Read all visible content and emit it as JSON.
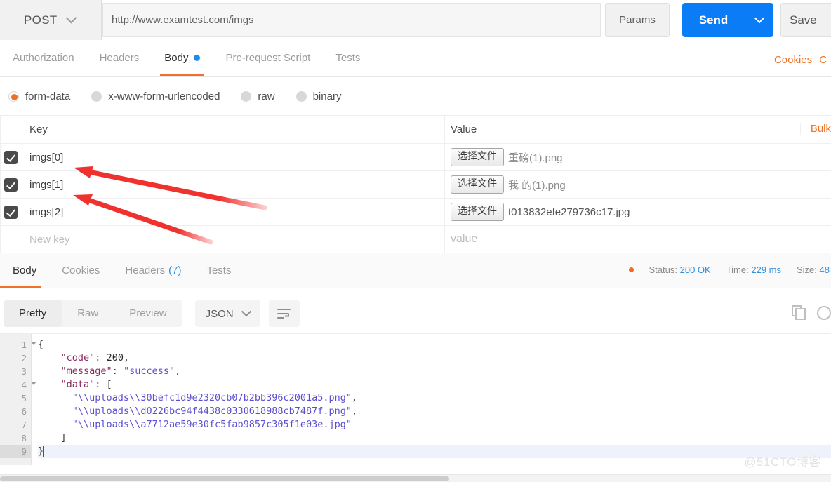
{
  "request": {
    "method": "POST",
    "url": "http://www.examtest.com/imgs",
    "params_label": "Params",
    "send_label": "Send",
    "save_label": "Save",
    "tabs": [
      {
        "label": "Authorization",
        "active": false,
        "dot": false
      },
      {
        "label": "Headers",
        "active": false,
        "dot": false
      },
      {
        "label": "Body",
        "active": true,
        "dot": true
      },
      {
        "label": "Pre-request Script",
        "active": false,
        "dot": false
      },
      {
        "label": "Tests",
        "active": false,
        "dot": false
      }
    ],
    "cookies_link": "Cookies",
    "cookies_link_cut": "C",
    "body_types": [
      {
        "label": "form-data",
        "selected": true
      },
      {
        "label": "x-www-form-urlencoded",
        "selected": false
      },
      {
        "label": "raw",
        "selected": false
      },
      {
        "label": "binary",
        "selected": false
      }
    ],
    "table": {
      "col_key": "Key",
      "col_value": "Value",
      "bulk_label": "Bulk",
      "file_btn_label": "选择文件",
      "new_key_placeholder": "New key",
      "new_value_placeholder": "value",
      "rows": [
        {
          "checked": true,
          "key": "imgs[0]",
          "file": "重磅(1).png",
          "grey": true
        },
        {
          "checked": true,
          "key": "imgs[1]",
          "file": "我 的(1).png",
          "grey": true
        },
        {
          "checked": true,
          "key": "imgs[2]",
          "file": "t013832efe279736c17.jpg",
          "grey": false
        }
      ]
    }
  },
  "response": {
    "tabs": [
      {
        "label": "Body",
        "active": true,
        "count": ""
      },
      {
        "label": "Cookies",
        "active": false,
        "count": ""
      },
      {
        "label": "Headers",
        "active": false,
        "count": "(7)"
      },
      {
        "label": "Tests",
        "active": false,
        "count": ""
      }
    ],
    "status_label": "Status:",
    "status_value": "200 OK",
    "time_label": "Time:",
    "time_value": "229 ms",
    "size_label": "Size:",
    "size_value": "48",
    "view_modes": [
      {
        "label": "Pretty",
        "active": true
      },
      {
        "label": "Raw",
        "active": false
      },
      {
        "label": "Preview",
        "active": false
      }
    ],
    "format": "JSON",
    "code_lines": [
      {
        "n": "1",
        "fold": true,
        "active": false,
        "segments": [
          {
            "t": "{",
            "c": "p"
          }
        ]
      },
      {
        "n": "2",
        "fold": false,
        "active": false,
        "segments": [
          {
            "t": "    ",
            "c": "p"
          },
          {
            "t": "\"code\"",
            "c": "k"
          },
          {
            "t": ": ",
            "c": "p"
          },
          {
            "t": "200",
            "c": "n"
          },
          {
            "t": ",",
            "c": "p"
          }
        ]
      },
      {
        "n": "3",
        "fold": false,
        "active": false,
        "segments": [
          {
            "t": "    ",
            "c": "p"
          },
          {
            "t": "\"message\"",
            "c": "k"
          },
          {
            "t": ": ",
            "c": "p"
          },
          {
            "t": "\"success\"",
            "c": "v"
          },
          {
            "t": ",",
            "c": "p"
          }
        ]
      },
      {
        "n": "4",
        "fold": true,
        "active": false,
        "segments": [
          {
            "t": "    ",
            "c": "p"
          },
          {
            "t": "\"data\"",
            "c": "k"
          },
          {
            "t": ": [",
            "c": "p"
          }
        ]
      },
      {
        "n": "5",
        "fold": false,
        "active": false,
        "segments": [
          {
            "t": "      ",
            "c": "p"
          },
          {
            "t": "\"\\\\uploads\\\\30befc1d9e2320cb07b2bb396c2001a5.png\"",
            "c": "v"
          },
          {
            "t": ",",
            "c": "p"
          }
        ]
      },
      {
        "n": "6",
        "fold": false,
        "active": false,
        "segments": [
          {
            "t": "      ",
            "c": "p"
          },
          {
            "t": "\"\\\\uploads\\\\d0226bc94f4438c0330618988cb7487f.png\"",
            "c": "v"
          },
          {
            "t": ",",
            "c": "p"
          }
        ]
      },
      {
        "n": "7",
        "fold": false,
        "active": false,
        "segments": [
          {
            "t": "      ",
            "c": "p"
          },
          {
            "t": "\"\\\\uploads\\\\a7712ae59e30fc5fab9857c305f1e03e.jpg\"",
            "c": "v"
          }
        ]
      },
      {
        "n": "8",
        "fold": false,
        "active": false,
        "segments": [
          {
            "t": "    ]",
            "c": "p"
          }
        ]
      },
      {
        "n": "9",
        "fold": false,
        "active": true,
        "segments": [
          {
            "t": "}",
            "c": "p"
          }
        ]
      }
    ]
  },
  "watermark": "@51CTO博客",
  "colors": {
    "accent_orange": "#ef7125",
    "send_blue": "#0a7cf5",
    "link_blue": "#2f8fe0",
    "annotation_red": "#f0322f"
  }
}
